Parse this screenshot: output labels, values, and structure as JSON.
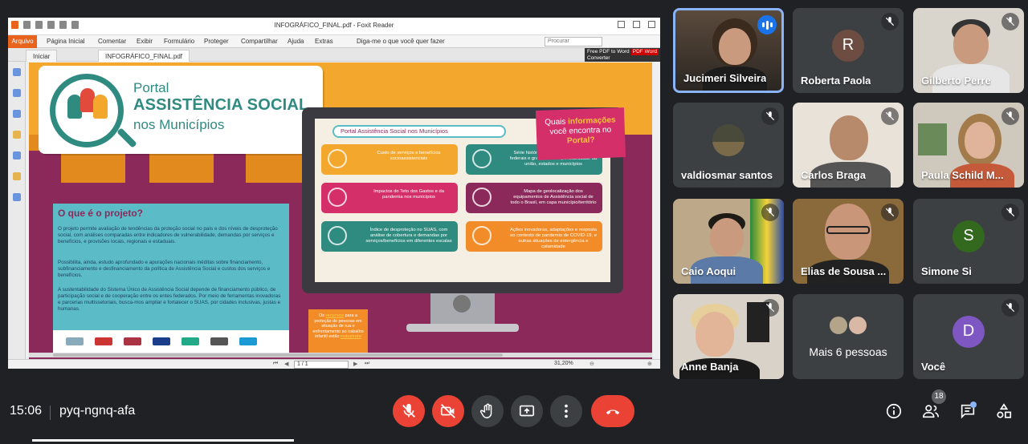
{
  "reader": {
    "title": "INFOGRÁFICO_FINAL.pdf - Foxit Reader",
    "menu": [
      "Arquivo",
      "Página Inicial",
      "Comentar",
      "Exibir",
      "Formulário",
      "Proteger",
      "Compartilhar",
      "Ajuda",
      "Extras"
    ],
    "tell_me": "Diga-me o que você quer fazer",
    "search_placeholder": "Procurar",
    "tabs": [
      "Iniciar",
      "INFOGRÁFICO_FINAL.pdf"
    ],
    "promo_line1": "Free PDF to Word",
    "promo_line2": "Converter",
    "promo_badge": "PDF Word",
    "page_field": "1 / 1",
    "zoom": "31,20%"
  },
  "infographic": {
    "logo_l1": "Portal",
    "logo_l2": "ASSISTÊNCIA SOCIAL",
    "logo_l3": "nos Municípios",
    "search_text": "Portal Assistência Social nos Municípios",
    "question_pre": "Quais ",
    "question_bold": "informações",
    "question_mid": " você encontra no ",
    "question_end": "Portal?",
    "proj_title": "O que é o projeto?",
    "proj_p1": "O projeto permite avaliação de tendências da proteção social no país e dos níveis de desproteção social, com análises comparadas entre indicadores de vulnerabilidade, demandas por serviços e benefícios, e provisões locais, regionais e estaduais.",
    "proj_p2": "Possibilita, ainda, estudo aprofundado e apurações nacionais inéditas sobre financiamento, subfinanciamento e desfinanciamento da política de Assistência Social e custos dos serviços e benefícios.",
    "proj_p3": "A sustentabilidade do Sistema Único de Assistência Social depende de financiamento público, de participação social e de cooperação entre os entes federados. Por meio de ferramentas inovadoras e parcerias multissetoriais, busca-mos ampliar e fortalecer o SUAS, por cidades inclusivas, justas e humanas.",
    "cards": [
      "Custo de serviços e benefícios socioassistenciais",
      "Série histórica de repasse de recursos federais e grau de corresponsabilidade da união, estados e municípios",
      "Impactos do Teto dos Gastos e da pandemia nos municípios",
      "Mapa de geolocalização dos equipamentos de Assistência social de todo o Brasil, em capa município/território",
      "Índice de desproteção no SUAS, com análise de cobertura e demandas por serviços/benefícios em diferentes escalas",
      "Ações inovadoras, adaptações e resposta ao contexto de pandemia de COVID-19, e outras situações de emergência e calamidade"
    ],
    "note_pre": "Os ",
    "note_bold": "recursos",
    "note_mid": " para a proteção de pessoas em situação de rua e enfrentamento ao trabalho infantil estão ",
    "note_end": "reduzindo"
  },
  "participants": [
    {
      "name": "Jucimeri Silveira",
      "speaking": true,
      "muted": false
    },
    {
      "name": "Roberta Paola",
      "initial": "R",
      "avatar_color": "#6d4c41",
      "muted": true
    },
    {
      "name": "Gilberto Perre",
      "muted": true
    },
    {
      "name": "valdiosmar santos",
      "muted": true
    },
    {
      "name": "Carlos Braga",
      "muted": true
    },
    {
      "name": "Paula Schild M...",
      "muted": true
    },
    {
      "name": "Caio Aoqui",
      "muted": true
    },
    {
      "name": "Elias de Sousa ...",
      "muted": true
    },
    {
      "name": "Simone Si",
      "initial": "S",
      "avatar_color": "#33691e",
      "muted": true
    },
    {
      "name": "Anne Banja",
      "muted": true
    },
    {
      "more_label": "Mais 6 pessoas"
    },
    {
      "name": "Você",
      "initial": "D",
      "avatar_color": "#7e57c2",
      "muted": true
    }
  ],
  "meeting": {
    "time": "15:06",
    "code": "pyq-ngnq-afa",
    "people_count": "18"
  },
  "colors": {
    "leave": "#ea4335",
    "control": "#3c4043",
    "speaking_border": "#8ab4f8"
  }
}
